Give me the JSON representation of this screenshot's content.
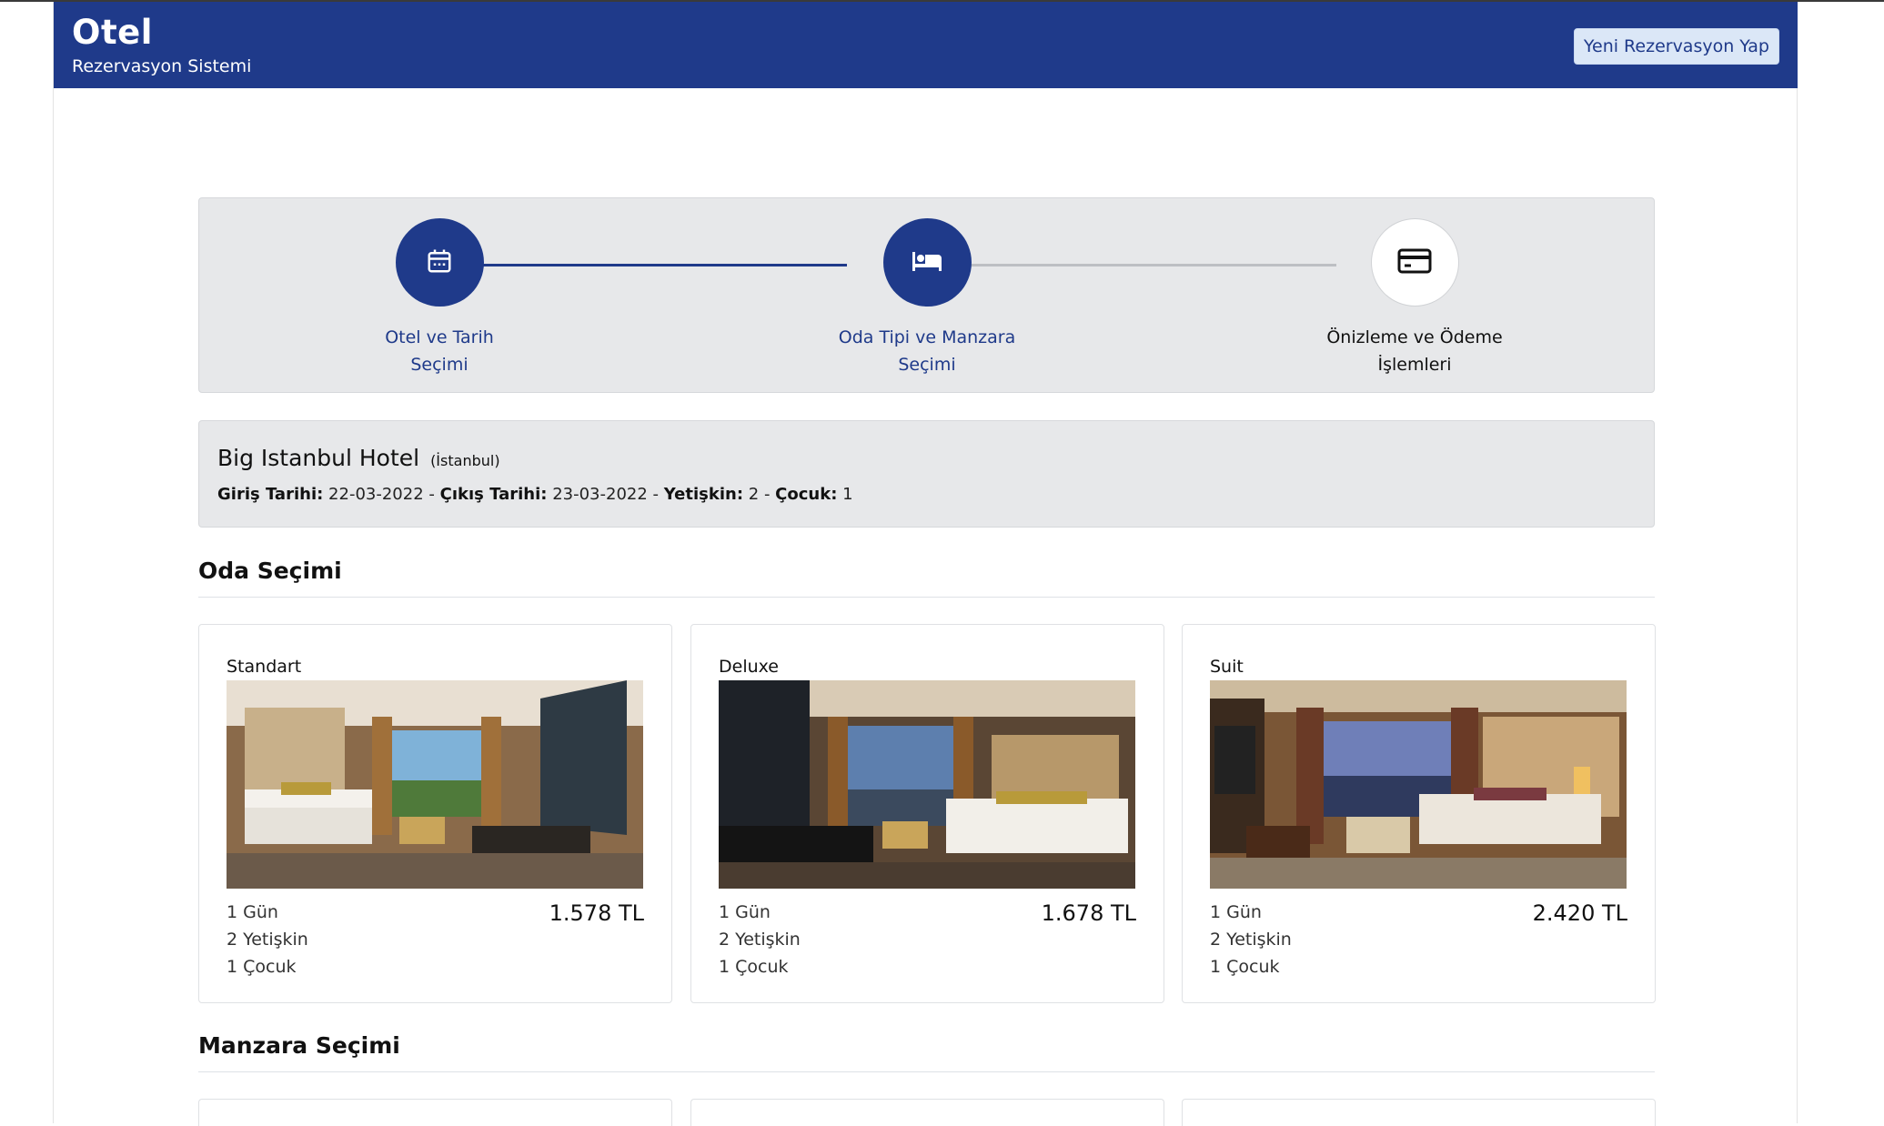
{
  "header": {
    "brand": "Otel",
    "subtitle": "Rezervasyon Sistemi",
    "new_reservation_label": "Yeni Rezervasyon Yap",
    "bg_color": "#1f3a8a"
  },
  "steps": [
    {
      "line1": "Otel ve Tarih",
      "line2": "Seçimi",
      "icon": "calendar-icon",
      "state": "completed"
    },
    {
      "line1": "Oda Tipi ve Manzara",
      "line2": "Seçimi",
      "icon": "bed-icon",
      "state": "active"
    },
    {
      "line1": "Önizleme ve Ödeme",
      "line2": "İşlemleri",
      "icon": "credit-card-icon",
      "state": "pending"
    }
  ],
  "summary": {
    "hotel_name": "Big Istanbul Hotel",
    "city": "(İstanbul)",
    "checkin_label": "Giriş Tarihi:",
    "checkin_value": "22-03-2022",
    "checkout_label": "Çıkış Tarihi:",
    "checkout_value": "23-03-2022",
    "adult_label": "Yetişkin:",
    "adult_value": "2",
    "child_label": "Çocuk:",
    "child_value": "1",
    "separator": "-"
  },
  "room_section": {
    "title": "Oda Seçimi",
    "rooms": [
      {
        "name": "Standart",
        "days": "1 Gün",
        "adults": "2 Yetişkin",
        "children": "1 Çocuk",
        "price": "1.578 TL"
      },
      {
        "name": "Deluxe",
        "days": "1 Gün",
        "adults": "2 Yetişkin",
        "children": "1 Çocuk",
        "price": "1.678 TL"
      },
      {
        "name": "Suit",
        "days": "1 Gün",
        "adults": "2 Yetişkin",
        "children": "1 Çocuk",
        "price": "2.420 TL"
      }
    ]
  },
  "view_section": {
    "title": "Manzara Seçimi"
  }
}
